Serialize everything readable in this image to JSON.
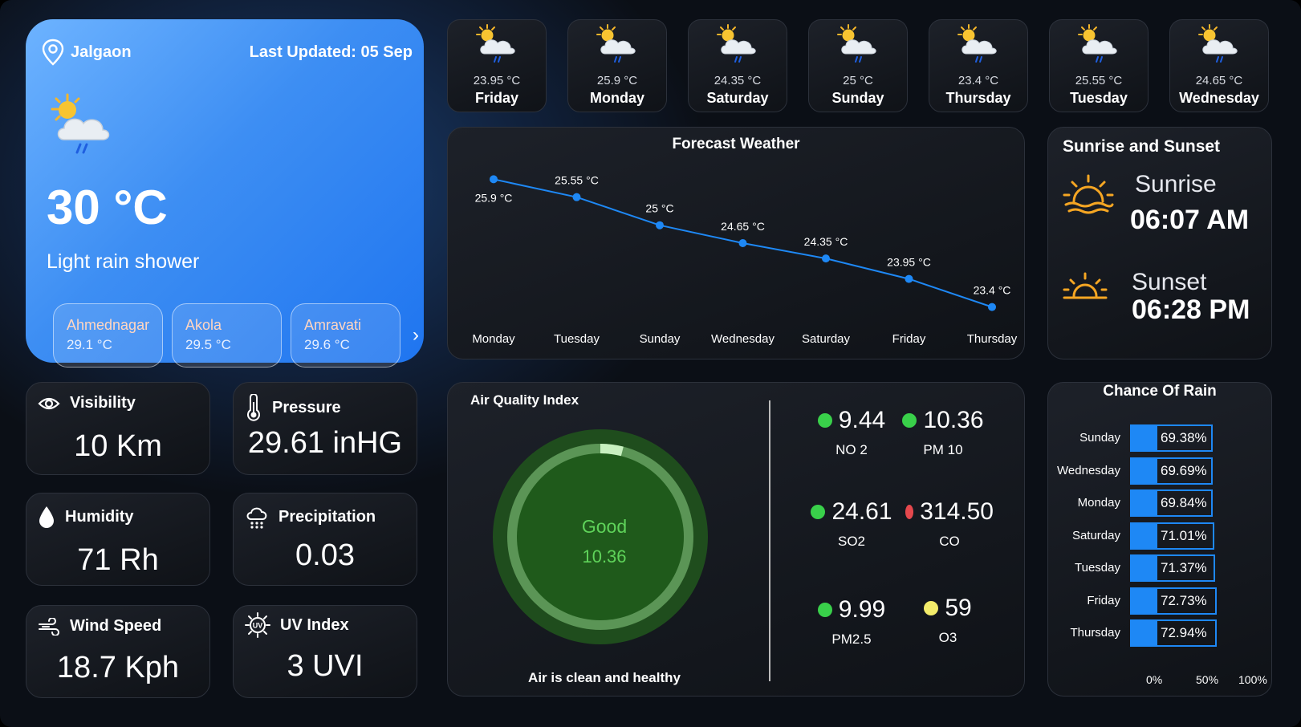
{
  "colors": {
    "main_gradient_start": "#6db3ff",
    "main_gradient_end": "#1f75f0",
    "line": "#1e88f5",
    "aqi_good": "#5fd35a",
    "dot_green": "#39d04a",
    "dot_red": "#e5484d",
    "dot_yellow": "#f3ec6a",
    "rain_bar": "#1e88f5"
  },
  "current": {
    "location": "Jalgaon",
    "last_updated": "Last Updated: 05 Sep",
    "temperature": "30 °C",
    "condition": "Light rain shower",
    "icon": "sun-cloud-rain-icon",
    "nearby": [
      {
        "name": "Ahmednagar",
        "temp": "29.1 °C"
      },
      {
        "name": "Akola",
        "temp": "29.5 °C"
      },
      {
        "name": "Amravati",
        "temp": "29.6 °C"
      }
    ]
  },
  "days": [
    {
      "temp": "23.95 °C",
      "day": "Friday"
    },
    {
      "temp": "25.9 °C",
      "day": "Monday"
    },
    {
      "temp": "24.35 °C",
      "day": "Saturday"
    },
    {
      "temp": "25 °C",
      "day": "Sunday"
    },
    {
      "temp": "23.4 °C",
      "day": "Thursday"
    },
    {
      "temp": "25.55 °C",
      "day": "Tuesday"
    },
    {
      "temp": "24.65 °C",
      "day": "Wednesday"
    }
  ],
  "forecast": {
    "title": "Forecast Weather"
  },
  "chart_data": [
    {
      "type": "line",
      "title": "Forecast Weather",
      "categories": [
        "Monday",
        "Tuesday",
        "Sunday",
        "Wednesday",
        "Saturday",
        "Friday",
        "Thursday"
      ],
      "values": [
        25.9,
        25.55,
        25,
        24.65,
        24.35,
        23.95,
        23.4
      ],
      "labels": [
        "25.9 °C",
        "25.55 °C",
        "25 °C",
        "24.65 °C",
        "24.35 °C",
        "23.95 °C",
        "23.4 °C"
      ],
      "grid": false
    },
    {
      "type": "bar",
      "title": "Chance Of Rain",
      "orientation": "horizontal",
      "categories": [
        "Sunday",
        "Wednesday",
        "Monday",
        "Saturday",
        "Tuesday",
        "Friday",
        "Thursday"
      ],
      "values": [
        69.38,
        69.69,
        69.84,
        71.01,
        71.37,
        72.73,
        72.94
      ],
      "labels": [
        "69.38%",
        "69.69%",
        "69.84%",
        "71.01%",
        "71.37%",
        "72.73%",
        "72.94%"
      ],
      "xticks": [
        "0%",
        "50%",
        "100%"
      ]
    }
  ],
  "sun": {
    "title": "Sunrise and Sunset",
    "sunrise_label": "Sunrise",
    "sunrise_time": "06:07 AM",
    "sunset_label": "Sunset",
    "sunset_time": "06:28 PM"
  },
  "stats": {
    "visibility": {
      "label": "Visibility",
      "value": "10 Km"
    },
    "pressure": {
      "label": "Pressure",
      "value": "29.61 inHG"
    },
    "humidity": {
      "label": "Humidity",
      "value": "71 Rh"
    },
    "precipitation": {
      "label": "Precipitation",
      "value": "0.03"
    },
    "wind": {
      "label": "Wind Speed",
      "value": "18.7 Kph"
    },
    "uv": {
      "label": "UV Index",
      "value": "3 UVI"
    }
  },
  "aqi": {
    "title": "Air Quality Index",
    "status": "Good",
    "value": "10.36",
    "gauge_fraction": 0.04,
    "footer": "Air is clean and healthy",
    "pollutants": [
      {
        "value": "9.44",
        "name": "NO 2",
        "dot": "green"
      },
      {
        "value": "10.36",
        "name": "PM 10",
        "dot": "green"
      },
      {
        "value": "24.61",
        "name": "SO2",
        "dot": "green"
      },
      {
        "value": "314.50",
        "name": "CO",
        "dot": "red"
      },
      {
        "value": "9.99",
        "name": "PM2.5",
        "dot": "green"
      },
      {
        "value": "59",
        "name": "O3",
        "dot": "yellow"
      }
    ]
  }
}
